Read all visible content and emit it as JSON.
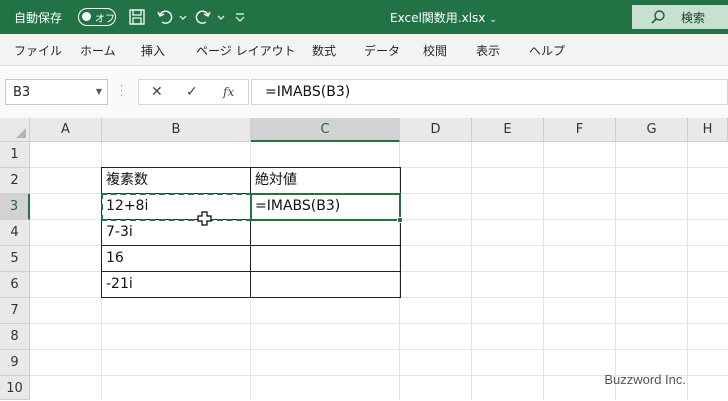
{
  "titlebar": {
    "autosave_label": "自動保存",
    "autosave_state": "オフ",
    "file_title": "Excel関数用.xlsx",
    "title_caret": "⌄",
    "search_label": "検索",
    "bg_color": "#217346"
  },
  "ribbon": {
    "tabs": [
      "ファイル",
      "ホーム",
      "挿入",
      "ページ レイアウト",
      "数式",
      "データ",
      "校閲",
      "表示",
      "ヘルプ"
    ]
  },
  "formula_bar": {
    "name_box": "B3",
    "cancel": "✕",
    "enter": "✓",
    "fx": "fx",
    "formula": "=IMABS(B3)"
  },
  "grid": {
    "columns": [
      "A",
      "B",
      "C",
      "D",
      "E",
      "F",
      "G",
      "H"
    ],
    "rows": [
      "1",
      "2",
      "3",
      "4",
      "5",
      "6",
      "7",
      "8",
      "9",
      "10"
    ],
    "selected_column": "C",
    "selected_row": "3",
    "header_row": {
      "b": "複素数",
      "c": "絶対値"
    },
    "data": [
      {
        "b": "12+8i",
        "c": "=IMABS(B3)"
      },
      {
        "b": "7-3i",
        "c": ""
      },
      {
        "b": "16",
        "c": ""
      },
      {
        "b": "-21i",
        "c": ""
      }
    ]
  },
  "watermark": "Buzzword Inc."
}
